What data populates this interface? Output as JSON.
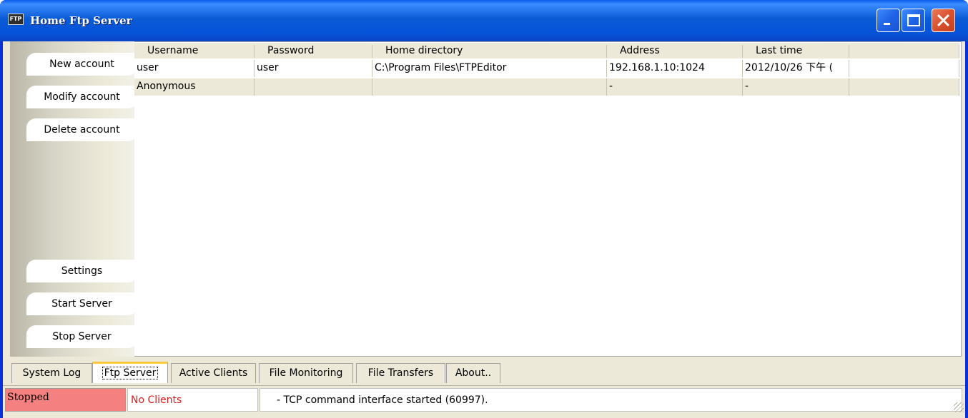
{
  "window": {
    "title": "Home Ftp Server",
    "icon_label": "FTP",
    "icon": "ftp-app-icon",
    "controls": [
      "minimize-icon",
      "maximize-icon",
      "close-icon"
    ]
  },
  "sidebar": {
    "new_account": "New account",
    "modify_account": "Modify account",
    "delete_account": "Delete account",
    "settings": "Settings",
    "start_server": "Start Server",
    "stop_server": "Stop Server"
  },
  "accounts": {
    "columns": [
      "Username",
      "Password",
      "Home directory",
      "Address",
      "Last time"
    ],
    "rows": [
      {
        "username": "user",
        "password": "user",
        "home": "C:\\Program Files\\FTPEditor",
        "address": "192.168.1.10:1024",
        "last_time": "2012/10/26 下午 ("
      },
      {
        "username": "Anonymous",
        "password": "",
        "home": "",
        "address": "-",
        "last_time": "-"
      }
    ]
  },
  "tabs": [
    "System Log",
    "Ftp Server",
    "Active Clients",
    "File Monitoring",
    "File Transfers",
    "About.."
  ],
  "active_tab": "Ftp Server",
  "status": {
    "server_state": "Stopped",
    "clients": "No Clients",
    "message": "- TCP command interface started (60997)."
  },
  "colors": {
    "titlebar": "#0553d9",
    "stopped_bg": "#f4807f",
    "clients_text": "#d82020",
    "active_tab_accent": "#ffc93c",
    "face": "#ece9d8"
  }
}
